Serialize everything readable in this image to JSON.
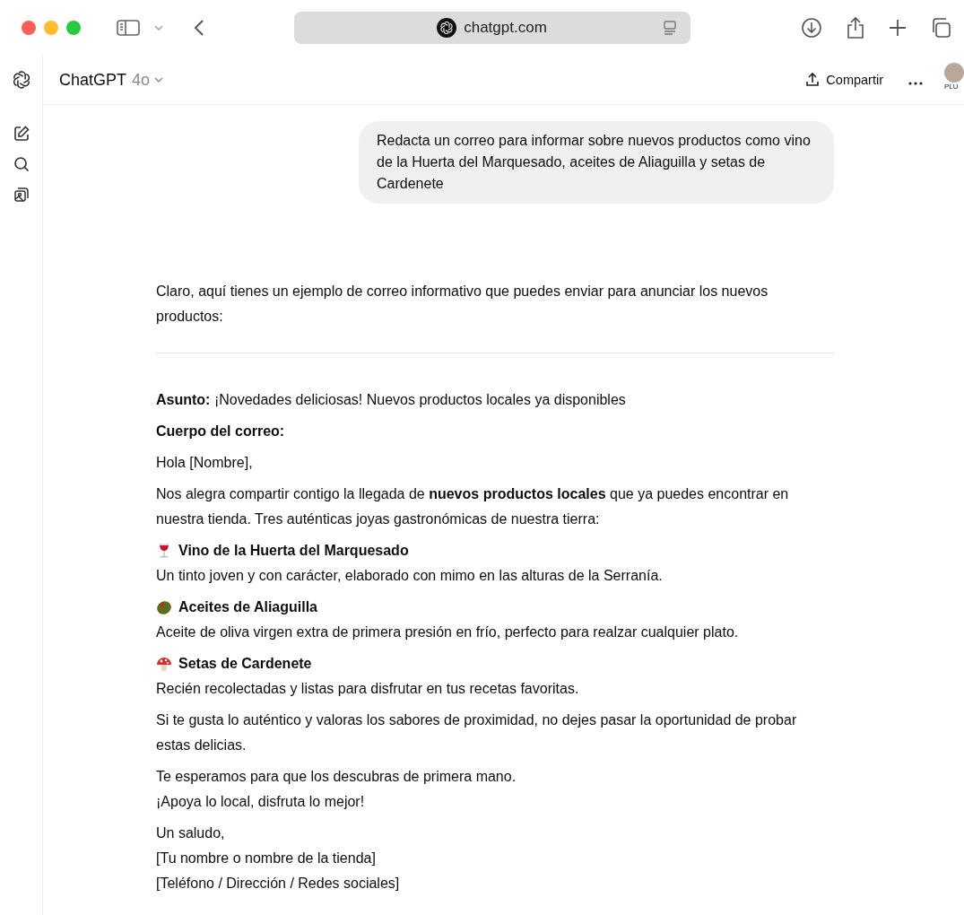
{
  "browser": {
    "url": "chatgpt.com"
  },
  "header": {
    "title": "ChatGPT",
    "model": "4o",
    "share": "Compartir",
    "avatar_badge": "PLU"
  },
  "user_message": "Redacta un correo para informar sobre nuevos productos como vino de la Huerta del Marquesado, aceites de Aliaguilla y setas de Cardenete",
  "response": {
    "intro": "Claro, aquí tienes un ejemplo de correo informativo que puedes enviar para anunciar los nuevos productos:",
    "blocks": [
      {
        "kind": "paragraph",
        "text": "**Asunto:** ¡Novedades deliciosas! Nuevos productos locales ya disponibles"
      },
      {
        "kind": "heading",
        "text": "Cuerpo del correo:"
      },
      {
        "kind": "paragraph",
        "text": "Hola [Nombre],"
      },
      {
        "kind": "paragraph",
        "text": "Nos alegra compartir contigo la llegada de **nuevos productos locales** que ya puedes encontrar en nuestra tienda. Tres auténticas joyas gastronómicas de nuestra tierra:"
      },
      {
        "kind": "product",
        "title": "Vino de la Huerta del Marquesado",
        "text": "Un tinto joven y con carácter, elaborado con mimo en las alturas de la Serranía."
      },
      {
        "kind": "product",
        "title": "Aceites de Aliaguilla",
        "text": "Aceite de oliva virgen extra de primera presión en frío, perfecto para realzar cualquier plato."
      },
      {
        "kind": "product",
        "title": "Setas de Cardenete",
        "text": "Recién recolectadas y listas para disfrutar en tus recetas favoritas."
      },
      {
        "kind": "paragraph",
        "text": "Si te gusta lo auténtico y valoras los sabores de proximidad, no dejes pasar la oportunidad de probar estas delicias."
      },
      {
        "kind": "lines",
        "lines": [
          "Te esperamos para que los descubras de primera mano.",
          "¡Apoya lo local, disfruta lo mejor!"
        ]
      },
      {
        "kind": "lines",
        "lines": [
          "Un saludo,",
          "[Tu nombre o nombre de la tienda]",
          "[Teléfono / Dirección / Redes sociales]"
        ]
      }
    ]
  }
}
